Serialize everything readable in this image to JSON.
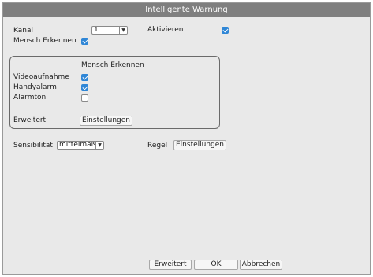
{
  "window": {
    "title": "Intelligente Warnung"
  },
  "kanal": {
    "label": "Kanal",
    "value": "1"
  },
  "aktivieren": {
    "label": "Aktivieren",
    "checked": true
  },
  "mensch_erkennen": {
    "label": "Mensch Erkennen",
    "checked": true
  },
  "group": {
    "title": "Mensch Erkennen",
    "videoaufnahme": {
      "label": "Videoaufnahme",
      "checked": true
    },
    "handyalarm": {
      "label": "Handyalarm",
      "checked": true
    },
    "alarmton": {
      "label": "Alarmton",
      "checked": false
    },
    "erweitert_label": "Erweitert",
    "settings_button": "Einstellungen"
  },
  "sensibilitaet": {
    "label": "Sensibilität",
    "value": "mittelmäß"
  },
  "regel": {
    "label": "Regel",
    "settings_button": "Einstellungen"
  },
  "footer": {
    "erweitert": "Erweitert",
    "ok": "OK",
    "abbrechen": "Abbrechen"
  }
}
